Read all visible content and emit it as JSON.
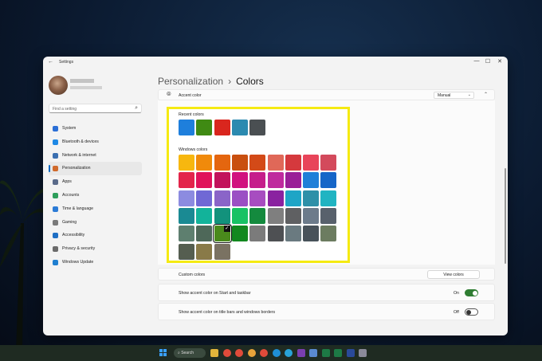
{
  "window": {
    "app_title": "Settings",
    "back_glyph": "←",
    "controls": [
      "—",
      "☐",
      "✕"
    ]
  },
  "sidebar": {
    "search_placeholder": "Find a setting",
    "search_glyph": "⌕",
    "items": [
      {
        "label": "System",
        "icon": "system-icon",
        "color": "#2b6fd6"
      },
      {
        "label": "Bluetooth & devices",
        "icon": "bluetooth-icon",
        "color": "#1e88e5"
      },
      {
        "label": "Network & internet",
        "icon": "network-icon",
        "color": "#3b6fb0"
      },
      {
        "label": "Personalization",
        "icon": "personalization-icon",
        "color": "#d06a2c"
      },
      {
        "label": "Apps",
        "icon": "apps-icon",
        "color": "#5a6a8a"
      },
      {
        "label": "Accounts",
        "icon": "accounts-icon",
        "color": "#2e9e5b"
      },
      {
        "label": "Time & language",
        "icon": "time-language-icon",
        "color": "#2b7bd6"
      },
      {
        "label": "Gaming",
        "icon": "gaming-icon",
        "color": "#7a7a7a"
      },
      {
        "label": "Accessibility",
        "icon": "accessibility-icon",
        "color": "#1f6fc4"
      },
      {
        "label": "Privacy & security",
        "icon": "privacy-icon",
        "color": "#6a6a6a"
      },
      {
        "label": "Windows Update",
        "icon": "windows-update-icon",
        "color": "#1f7fd0"
      }
    ],
    "active_index": 3,
    "accent_color": "#0067c0"
  },
  "breadcrumb": {
    "parent": "Personalization",
    "separator": "›",
    "current": "Colors"
  },
  "accent": {
    "label": "Accent color",
    "dropdown_value": "Manual",
    "dropdown_glyph": "⌄",
    "collapse_glyph": "⌃"
  },
  "colors_panel": {
    "recent_label": "Recent colors",
    "windows_label": "Windows colors",
    "highlight_color": "#f5ea12",
    "recent_colors": [
      "#1e7fdc",
      "#3f8a13",
      "#d9261e",
      "#2b8ab0",
      "#4a4f52"
    ],
    "windows_colors": [
      [
        "#f7b70f",
        "#f08a0b",
        "#e4660f",
        "#c94f0f",
        "#d34a18",
        "#e06858",
        "#d5393d",
        "#e8455a",
        "#d34a5c"
      ],
      [
        "#e3254b",
        "#e0135a",
        "#c2135b",
        "#d1127f",
        "#c51e8b",
        "#bf2a9e",
        "#9a1e98",
        "#1f7fd8",
        "#1666c8"
      ],
      [
        "#8c8be0",
        "#7068d5",
        "#8a64c8",
        "#9b4fc4",
        "#a74dc0",
        "#8a22a0",
        "#1ea5c6",
        "#2e90a8",
        "#20b4c2"
      ],
      [
        "#1a8a93",
        "#12b39a",
        "#12927c",
        "#17c264",
        "#148a3e",
        "#7f7f7f",
        "#5f6062",
        "#6c7b8b",
        "#58616c"
      ],
      [
        "#5e7f6f",
        "#4e6859",
        "#4a8a1c",
        "#12881f",
        "#7b7b7b",
        "#4e5053",
        "#6a7a80",
        "#48525a",
        "#6c7c60"
      ],
      [
        "#555e50",
        "#897a48",
        "#7a7262"
      ]
    ],
    "selected": {
      "row": 4,
      "col": 2
    },
    "check_glyph": "✓"
  },
  "custom_colors": {
    "label": "Custom colors",
    "button": "View colors"
  },
  "start_taskbar": {
    "label": "Show accent color on Start and taskbar",
    "state": "On",
    "toggle_on": true,
    "toggle_color": "#2f7d32"
  },
  "title_bars": {
    "label": "Show accent color on title bars and windows borders",
    "state": "Off",
    "toggle_on": false
  },
  "taskbar": {
    "search_label": "⌕ Search",
    "apps": [
      "file-explorer-icon",
      "chrome-icon",
      "chrome-icon",
      "chrome-icon",
      "chrome-icon",
      "edge-icon",
      "edge-icon",
      "onenote-icon",
      "notepad-icon",
      "excel-icon",
      "excel-icon",
      "photoshop-icon",
      "settings-icon"
    ],
    "app_colors": [
      "#e2b53b",
      "#e04b3a",
      "#e04b3a",
      "#e8a33a",
      "#e04b3a",
      "#1f8fd6",
      "#29a4d8",
      "#7a3fb0",
      "#5a8ad0",
      "#1d7a45",
      "#1d7a45",
      "#2a4a9a",
      "#8a8a9a"
    ]
  }
}
